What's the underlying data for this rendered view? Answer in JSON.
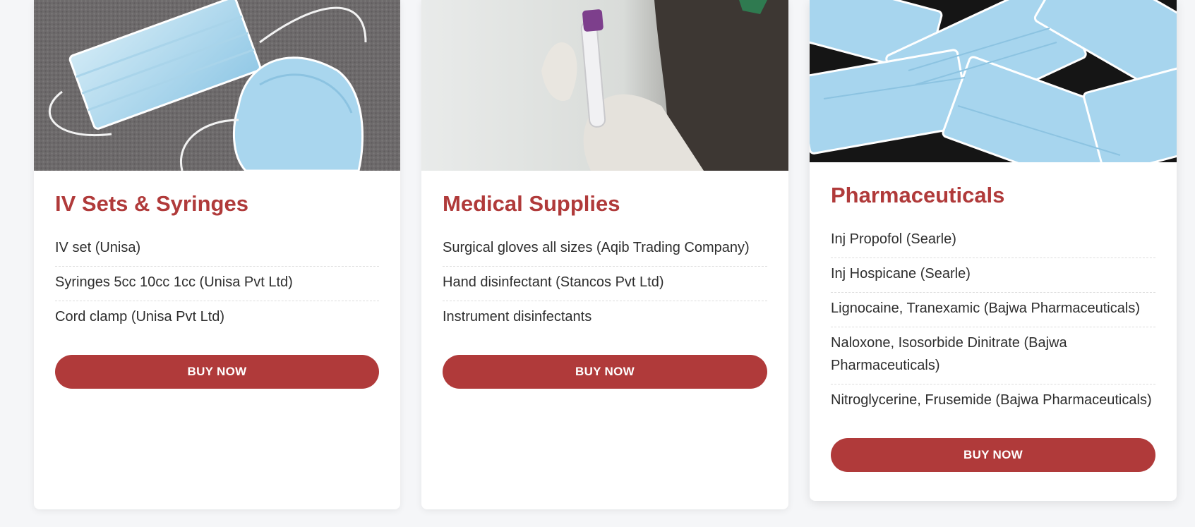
{
  "colors": {
    "accent": "#b03a3a",
    "page_background": "#f5f6f8",
    "card_background": "#ffffff",
    "text": "#2e2e2e"
  },
  "cards": [
    {
      "title": "IV Sets & Syringes",
      "image": "surgical-masks-on-grey-fabric",
      "items": [
        "IV set (Unisa)",
        "Syringes 5cc 10cc 1cc (Unisa Pvt Ltd)",
        "Cord clamp (Unisa Pvt Ltd)"
      ],
      "button_label": "BUY NOW"
    },
    {
      "title": "Medical Supplies",
      "image": "gloved-hand-holding-test-tube",
      "items": [
        "Surgical gloves all sizes (Aqib Trading Company)",
        "Hand disinfectant (Stancos Pvt Ltd)",
        "Instrument disinfectants"
      ],
      "button_label": "BUY NOW"
    },
    {
      "title": "Pharmaceuticals",
      "image": "pile-of-surgical-masks",
      "items": [
        "Inj Propofol (Searle)",
        "Inj Hospicane (Searle)",
        "Lignocaine, Tranexamic (Bajwa Pharmaceuticals)",
        "Naloxone, Isosorbide Dinitrate (Bajwa Pharmaceuticals)",
        "Nitroglycerine, Frusemide (Bajwa Pharmaceuticals)"
      ],
      "button_label": "BUY NOW"
    }
  ]
}
